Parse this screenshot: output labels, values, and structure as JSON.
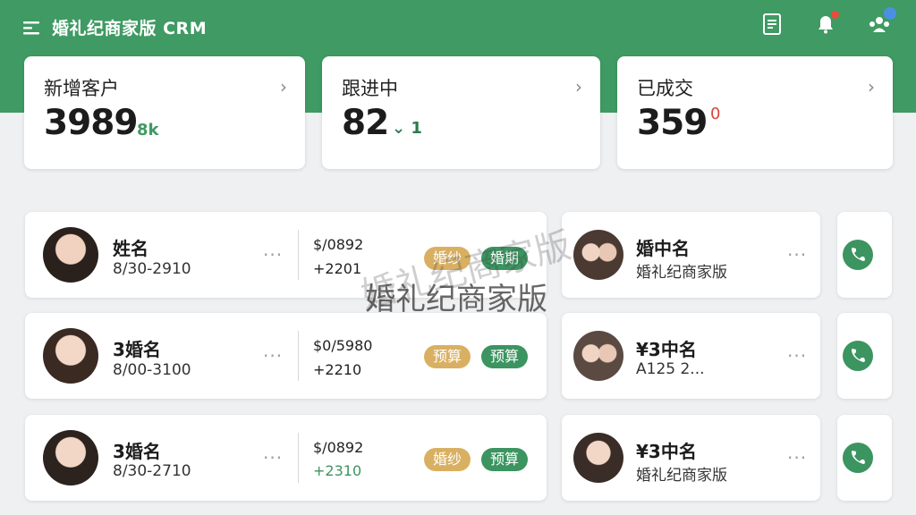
{
  "app": {
    "title": "婚礼纪商家版 CRM"
  },
  "header_icons": [
    {
      "icon": "document-icon"
    },
    {
      "icon": "bell-icon",
      "badge_color": "#e74c3c"
    },
    {
      "icon": "team-icon",
      "badge_color": "#4a90e2"
    }
  ],
  "stats": [
    {
      "label": "新增客户",
      "value": "3989",
      "delta": "8k",
      "delta_color": "#3f9a63"
    },
    {
      "label": "跟进中",
      "value": "82",
      "delta": "⌄ 1",
      "delta_color": "#2f7a4f"
    },
    {
      "label": "已成交",
      "value": "359",
      "delta": "0",
      "delta_color": "#d9453a"
    }
  ],
  "customers_left": [
    {
      "name": "姓名",
      "date": "8/30-2910",
      "amount": "$/0892",
      "change": "+2201",
      "change_color": "#222",
      "tag1": "婚纱",
      "tag2": "婚期"
    },
    {
      "name": "3婚名",
      "date": "8/00-3100",
      "amount": "$0/5980",
      "change": "+2210",
      "change_color": "#222",
      "tag1": "预算",
      "tag2": "预算"
    },
    {
      "name": "3婚名",
      "date": "8/30-2710",
      "amount": "$/0892",
      "change": "+2310",
      "change_color": "#3c9460",
      "tag1": "婚纱",
      "tag2": "预算"
    }
  ],
  "customers_right": [
    {
      "name": "婚中名",
      "sub": "婚礼纪商家版"
    },
    {
      "name": "¥3中名",
      "sub": "A125 2..."
    },
    {
      "name": "¥3中名",
      "sub": "婚礼纪商家版"
    }
  ],
  "watermark": "婚礼纪商家版",
  "colors": {
    "brand": "#3f9a63",
    "gold": "#d9b062",
    "green": "#3c9460"
  }
}
